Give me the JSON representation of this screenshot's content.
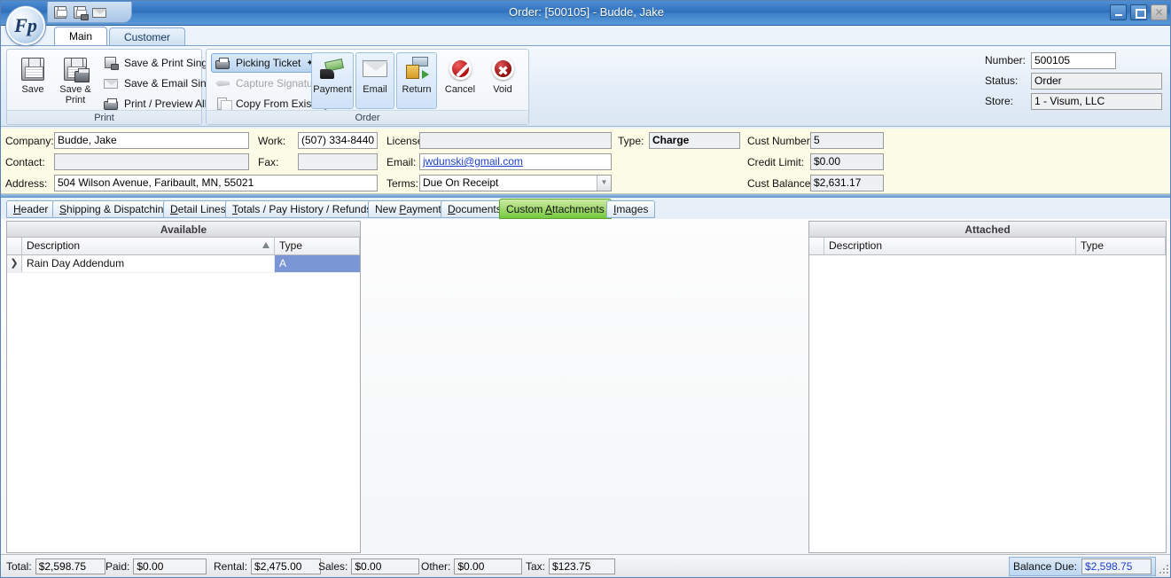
{
  "window": {
    "title": "Order: [500105] - Budde, Jake",
    "logo_text": "Fp",
    "quick_access": [
      {
        "name": "save-icon",
        "tip": "Save"
      },
      {
        "name": "save-print-icon",
        "tip": "Save & Print"
      },
      {
        "name": "email-icon",
        "tip": "Email"
      }
    ],
    "controls": {
      "minimize": "minimize-button",
      "maximize": "maximize-button",
      "close_glyph": "✕"
    }
  },
  "ribbon_tabs": [
    {
      "label": "Main",
      "active": true
    },
    {
      "label": "Customer",
      "active": false
    }
  ],
  "ribbon": {
    "groups": [
      {
        "label": "Print",
        "big_buttons": [
          {
            "label": "Save",
            "icon": "floppy-disk-icon"
          },
          {
            "label": "Save & Print",
            "icon": "floppy-disk-printer-icon"
          }
        ],
        "menu_items": [
          {
            "label": "Save & Print Single",
            "icon": "save-print-single-icon",
            "disabled": false,
            "dropdown": false
          },
          {
            "label": "Save & Email Single",
            "icon": "save-email-single-icon",
            "disabled": false,
            "dropdown": false
          },
          {
            "label": "Print / Preview All",
            "icon": "printer-icon",
            "disabled": false,
            "dropdown": true
          }
        ]
      },
      {
        "label": "Order",
        "menu_items": [
          {
            "label": "Picking Ticket",
            "icon": "printer-icon",
            "disabled": false,
            "dropdown": true,
            "highlighted": true
          },
          {
            "label": "Capture Signature",
            "icon": "pen-icon",
            "disabled": true,
            "dropdown": false
          },
          {
            "label": "Copy From Existing",
            "icon": "copy-icon",
            "disabled": false,
            "dropdown": false
          }
        ],
        "big_buttons": [
          {
            "label": "Payment",
            "icon": "cash-hand-icon",
            "highlighted": true
          },
          {
            "label": "Email",
            "icon": "envelope-icon",
            "highlighted": true
          },
          {
            "label": "Return",
            "icon": "return-package-icon",
            "highlighted": true
          },
          {
            "label": "Cancel",
            "icon": "cancel-circle-icon",
            "highlighted": false
          },
          {
            "label": "Void",
            "icon": "void-circle-icon",
            "highlighted": false
          }
        ]
      }
    ]
  },
  "header_fields": [
    {
      "label": "Number:",
      "value": "500105",
      "readonly": false
    },
    {
      "label": "Status:",
      "value": "Order",
      "readonly": true
    },
    {
      "label": "Store:",
      "value": "1 - Visum, LLC",
      "readonly": true
    }
  ],
  "customer_panel": {
    "company_label": "Company:",
    "company_value": "Budde, Jake",
    "contact_label": "Contact:",
    "contact_value": "",
    "address_label": "Address:",
    "address_value": "504 Wilson Avenue, Faribault, MN, 55021",
    "work_label": "Work:",
    "work_value": "(507) 334-8440",
    "fax_label": "Fax:",
    "fax_value": "",
    "terms_label": "Terms:",
    "terms_value": "Due On Receipt",
    "license_label": "License:",
    "license_value": "",
    "email_label": "Email:",
    "email_value": "jwdunski@gmail.com",
    "type_label": "Type:",
    "type_value": "Charge",
    "cust_number_label": "Cust Number:",
    "cust_number_value": "5",
    "credit_limit_label": "Credit Limit:",
    "credit_limit_value": "$0.00",
    "cust_balance_label": "Cust Balance:",
    "cust_balance_value": "$2,631.17"
  },
  "inner_tabs": [
    {
      "label": "Header",
      "mnemonic": "H",
      "active": false
    },
    {
      "label": "Shipping & Dispatching",
      "mnemonic": "S",
      "active": false
    },
    {
      "label": "Detail Lines",
      "mnemonic": "D",
      "active": false
    },
    {
      "label": "Totals / Pay History / Refunds",
      "mnemonic": "T",
      "active": false
    },
    {
      "label": "New Payment",
      "mnemonic": "P",
      "active": false
    },
    {
      "label": "Documents",
      "mnemonic": "D",
      "active": false
    },
    {
      "label": "Custom Attachments",
      "mnemonic": "A",
      "active": true
    },
    {
      "label": "Images",
      "mnemonic": "I",
      "active": false
    }
  ],
  "available_grid": {
    "title": "Available",
    "columns": [
      "Description",
      "Type"
    ],
    "sort_column": "Description",
    "sort_direction": "asc",
    "rows": [
      {
        "indicator": "❯",
        "description": "Rain Day Addendum",
        "type": "A",
        "type_selected": true
      }
    ]
  },
  "attached_grid": {
    "title": "Attached",
    "columns": [
      "Description",
      "Type"
    ],
    "rows": []
  },
  "status_bar": {
    "items": [
      {
        "label": "Total:",
        "value": "$2,598.75"
      },
      {
        "label": "Paid:",
        "value": "$0.00"
      },
      {
        "label": "Rental:",
        "value": "$2,475.00"
      },
      {
        "label": "Sales:",
        "value": "$0.00"
      },
      {
        "label": "Other:",
        "value": "$0.00"
      },
      {
        "label": "Tax:",
        "value": "$123.75"
      }
    ],
    "balance_due_label": "Balance Due:",
    "balance_due_value": "$2,598.75"
  },
  "colors": {
    "title_bar": "#3c80c9",
    "active_tab_green": "#76c93f",
    "selection_blue": "#7b96d4",
    "panel_yellow": "#fbfbe6",
    "link_blue": "#1b3fcf"
  }
}
